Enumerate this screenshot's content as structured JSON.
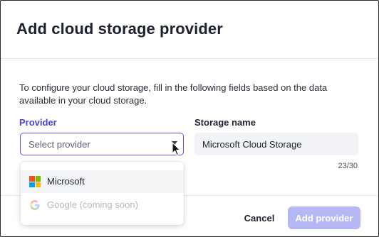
{
  "dialog": {
    "title": "Add cloud storage provider",
    "description": "To configure your cloud storage, fill in the following fields based on the data available in your cloud storage."
  },
  "provider": {
    "label": "Provider",
    "placeholder": "Select provider",
    "options": [
      {
        "label": "Microsoft",
        "icon": "microsoft-logo-icon",
        "enabled": true,
        "highlighted": true
      },
      {
        "label": "Google (coming soon)",
        "icon": "google-logo-icon",
        "enabled": false,
        "highlighted": false
      }
    ]
  },
  "storage_name": {
    "label": "Storage name",
    "value": "Microsoft Cloud Storage",
    "counter": "23/30"
  },
  "footer": {
    "cancel_label": "Cancel",
    "submit_label": "Add provider",
    "submit_disabled": true
  },
  "colors": {
    "accent": "#4b3fe0",
    "focus_border": "#5b4ff0",
    "disabled_button": "#b6b8f6",
    "microsoft": [
      "#f25022",
      "#7fba00",
      "#00a4ef",
      "#ffb900"
    ]
  }
}
